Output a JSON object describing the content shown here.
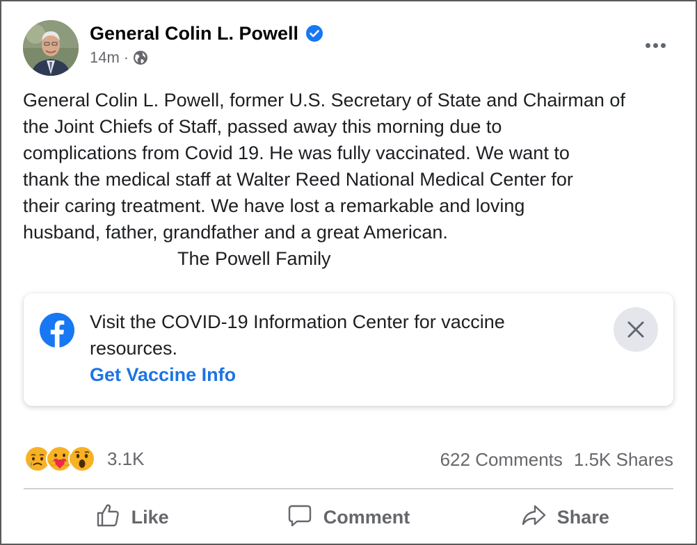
{
  "post": {
    "author": "General Colin L. Powell",
    "time": "14m",
    "separator": "·",
    "paragraph_lines": [
      "General Colin L. Powell, former U.S. Secretary of State and Chairman of",
      "the Joint Chiefs of Staff, passed away this morning due to",
      "complications from Covid 19.  He was fully vaccinated.  We want to",
      "thank the medical staff at Walter Reed National Medical Center for",
      "their caring treatment.  We have lost a remarkable and loving",
      "husband, father, grandfather and a great American."
    ],
    "signature": "The Powell Family"
  },
  "info_card": {
    "text_line1": "Visit the COVID-19 Information Center for vaccine",
    "text_line2": "resources.",
    "link": "Get Vaccine Info"
  },
  "stats": {
    "reaction_count": "3.1K",
    "comments": "622 Comments",
    "shares": "1.5K Shares"
  },
  "actions": {
    "like": "Like",
    "comment": "Comment",
    "share": "Share"
  },
  "colors": {
    "link_blue": "#1b74e4",
    "verified_blue": "#1877f2",
    "secondary_text": "#65676b"
  },
  "icons": {
    "verified": "verified-badge-icon",
    "audience": "globe-icon",
    "more": "more-options-icon",
    "facebook": "facebook-logo-icon",
    "close": "close-icon",
    "reactions": [
      "sad-reaction-icon",
      "care-reaction-icon",
      "wow-reaction-icon"
    ],
    "like": "thumbs-up-icon",
    "comment": "comment-bubble-icon",
    "share": "share-arrow-icon"
  }
}
